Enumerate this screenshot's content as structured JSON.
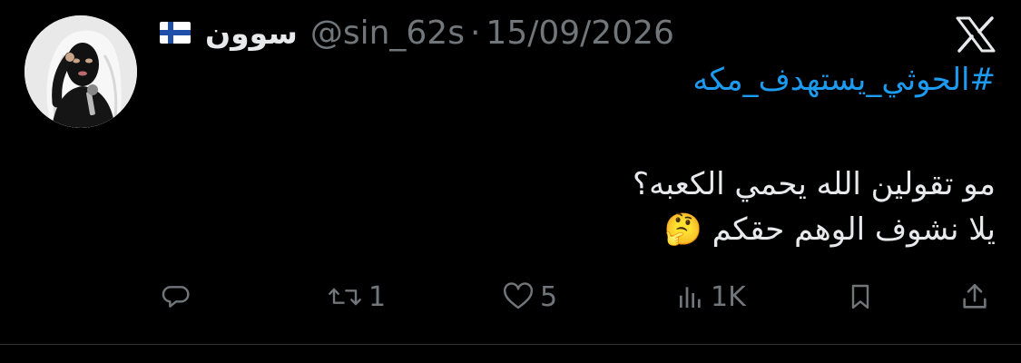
{
  "tweet": {
    "author": {
      "display_name": "سوون",
      "flag_icon": "finland-flag-icon",
      "handle": "@sin_62s",
      "separator": "·",
      "date": "15/09/2026"
    },
    "platform_icon": "x-logo-icon",
    "hashtag": "#الحوثي_يستهدف_مكه",
    "body_lines": [
      "مو تقولين الله يحمي الكعبه؟",
      "يلا نشوف الوهم حقكم 🤔"
    ]
  },
  "actions": {
    "reply": {
      "icon": "reply-icon",
      "count": ""
    },
    "retweet": {
      "icon": "retweet-icon",
      "count": "1"
    },
    "like": {
      "icon": "heart-icon",
      "count": "5"
    },
    "views": {
      "icon": "views-icon",
      "count": "1K"
    },
    "bookmark": {
      "icon": "bookmark-icon"
    },
    "share": {
      "icon": "share-icon"
    }
  },
  "colors": {
    "background": "#000000",
    "text": "#e7e9ea",
    "muted": "#71767b",
    "link": "#1d9bf0",
    "divider": "#2f3336"
  }
}
